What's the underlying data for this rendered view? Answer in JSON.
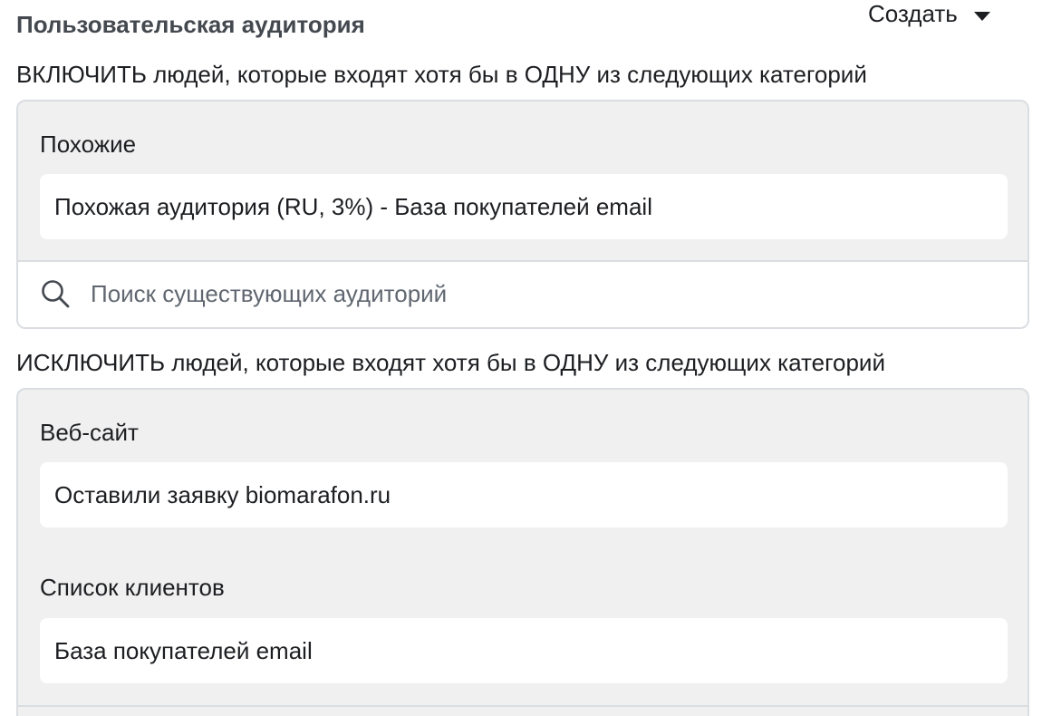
{
  "header": {
    "title": "Пользовательская аудитория",
    "create_label": "Создать"
  },
  "include": {
    "label": "ВКЛЮЧИТЬ людей, которые входят хотя бы в ОДНУ из следующих категорий",
    "groups": [
      {
        "label": "Похожие",
        "items": [
          "Похожая аудитория (RU, 3%) - База покупателей email"
        ]
      }
    ],
    "search": {
      "placeholder": "Поиск существующих аудиторий",
      "value": ""
    }
  },
  "exclude": {
    "label": "ИСКЛЮЧИТЬ людей, которые входят хотя бы в ОДНУ из следующих категорий",
    "groups": [
      {
        "label": "Веб-сайт",
        "items": [
          "Оставили заявку biomarafon.ru"
        ]
      },
      {
        "label": "Список клиентов",
        "items": [
          "База покупателей email"
        ]
      }
    ]
  },
  "icons": {
    "search": "search-icon",
    "dropdown": "caret-down-icon"
  }
}
